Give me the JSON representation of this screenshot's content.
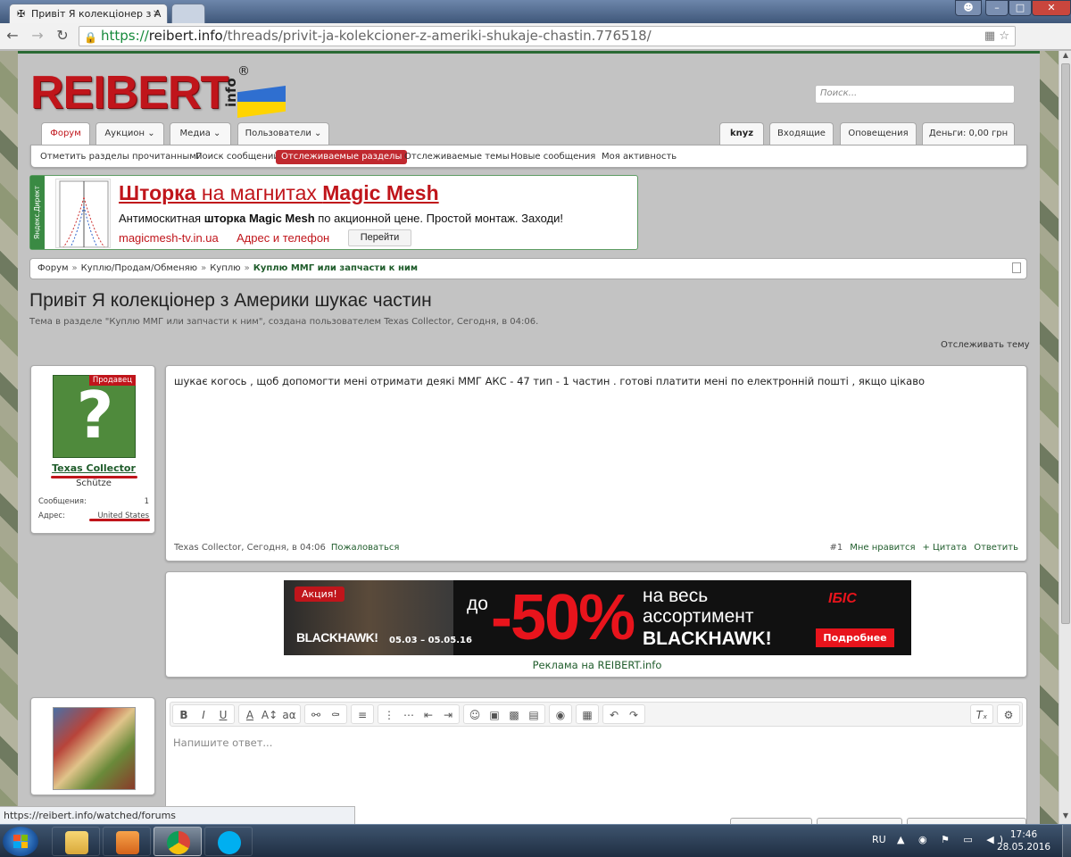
{
  "browser": {
    "tab_title": "Привіт Я колекціонер з А",
    "tab_icon": "✠",
    "tab_close": "×",
    "url_scheme": "https://",
    "url_host": "reibert.info",
    "url_path": "/threads/privit-ja-kolekcioner-z-ameriki-shukaje-chastin.776518/",
    "status_url": "https://reibert.info/watched/forums"
  },
  "site": {
    "logo_text": "REIBERT",
    "logo_suffix": "info",
    "logo_mark": "®",
    "flag_colors": [
      "#2f6fd0",
      "#ffd400"
    ],
    "search_placeholder": "Поиск..."
  },
  "nav": {
    "tabs": [
      {
        "label": "Форум"
      },
      {
        "label": "Аукцион ⌄"
      },
      {
        "label": "Медиа ⌄"
      },
      {
        "label": "Пользователи ⌄"
      }
    ],
    "right_tabs": [
      {
        "label": "knyz"
      },
      {
        "label": "Входящие"
      },
      {
        "label": "Оповещения"
      },
      {
        "label": "Деньги: 0,00 грн"
      }
    ],
    "sub_items": [
      {
        "label": "Отметить разделы прочитанными"
      },
      {
        "label": "Поиск сообщений"
      },
      {
        "label": "Отслеживаемые разделы"
      },
      {
        "label": "Отслеживаемые темы"
      },
      {
        "label": "Новые сообщения"
      },
      {
        "label": "Моя активность"
      }
    ]
  },
  "yandex_ad": {
    "side_label": "Яндекс.Директ",
    "title_a": "Шторка",
    "title_b": " на магнитах ",
    "title_c": "Magic Mesh",
    "text_a": "Антимоскитная ",
    "text_b": "шторка Magic Mesh",
    "text_c": " по акционной цене. Простой монтаж. Заходи!",
    "link": "magicmesh-tv.in.ua",
    "address": "Адрес и телефон",
    "button": "Перейти"
  },
  "breadcrumb": {
    "items": [
      "Форум",
      "Куплю/Продам/Обменяю",
      "Куплю"
    ],
    "current": "Куплю ММГ или запчасти к ним",
    "separator": "»"
  },
  "thread": {
    "title": "Привіт Я колекціонер з Америки шукає частин",
    "subtitle": "Тема в разделе \"Куплю ММГ или запчасти к ним\", создана пользователем Texas Collector, Сегодня, в 04:06.",
    "watch": "Отслеживать тему"
  },
  "post": {
    "badge": "Продавец",
    "avatar_glyph": "?",
    "username": "Texas Collector",
    "user_title": "Schütze",
    "messages_label": "Сообщения:",
    "messages_value": "1",
    "address_label": "Адрес:",
    "address_value": "United States",
    "text": "шукає когось , щоб допомогти мені отримати деякі ММГ АКС - 47 тип - 1 частин . готові платити мені по електронній пошті , якщо цікаво",
    "meta": "Texas Collector, Сегодня, в 04:06",
    "report": "Пожаловаться",
    "number": "#1",
    "like": "Мне нравится",
    "quote": "+ Цитата",
    "reply": "Ответить"
  },
  "banner": {
    "promo": "Акция!",
    "brand": "BLACKHAWK!",
    "dates": "05.03 – 05.05.16",
    "do": "до",
    "discount": "-50%",
    "line1": "на весь",
    "line2": "ассортимент",
    "line3": "BLACKHAWK!",
    "shop": "IБIС",
    "more": "Подробнее",
    "caption": "Реклама на REIBERT.info"
  },
  "editor": {
    "placeholder": "Напишите ответ..."
  },
  "taskbar": {
    "lang": "RU",
    "tray": "▲ ◉ ⚑ ▭ ◀)",
    "time": "17:46",
    "date": "28.05.2016"
  }
}
